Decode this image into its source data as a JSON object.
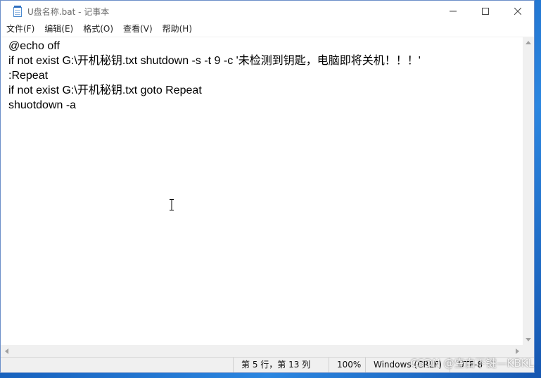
{
  "window": {
    "title": "U盘名称.bat - 记事本",
    "icon": "notepad-icon"
  },
  "controls": {
    "minimize_icon": "minimize-icon",
    "maximize_icon": "maximize-icon",
    "close_icon": "close-icon"
  },
  "menu": {
    "items": [
      {
        "label": "文件(F)"
      },
      {
        "label": "编辑(E)"
      },
      {
        "label": "格式(O)"
      },
      {
        "label": "查看(V)"
      },
      {
        "label": "帮助(H)"
      }
    ]
  },
  "editor": {
    "lines": [
      "@echo off",
      "if not exist G:\\开机秘钥.txt shutdown -s -t 9 -c '未检测到钥匙，电脑即将关机！！！'",
      ":Repeat",
      "if not exist G:\\开机秘钥.txt goto Repeat",
      "shuotdown -a"
    ]
  },
  "status": {
    "position": "第 5 行，第 13 列",
    "zoom": "100%",
    "line_ending": "Windows (CRLF)",
    "encoding": "UTF-8"
  },
  "watermark": "CSDN @空白下键—KBKL"
}
